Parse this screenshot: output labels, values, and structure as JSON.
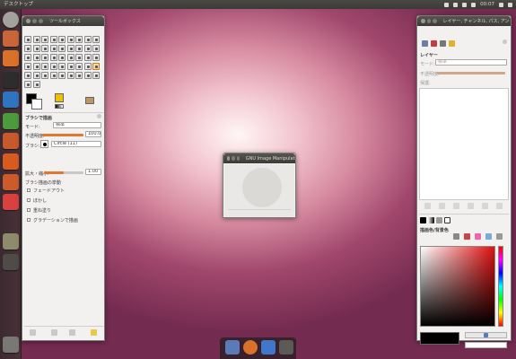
{
  "topbar": {
    "title": "デスクトップ",
    "time": "00:07"
  },
  "launcher": {
    "items": [
      {
        "name": "dash-home-icon",
        "color": "#a3a29d"
      },
      {
        "name": "files-icon",
        "color": "#c8653a"
      },
      {
        "name": "firefox-icon",
        "color": "#d9712a"
      },
      {
        "name": "terminal-icon",
        "color": "#2d2d2d"
      },
      {
        "name": "writer-icon",
        "color": "#2f74c0"
      },
      {
        "name": "calc-icon",
        "color": "#4b9a3b"
      },
      {
        "name": "impress-icon",
        "color": "#c75a2c"
      },
      {
        "name": "software-center-icon",
        "color": "#d85a1f"
      },
      {
        "name": "ubuntu-one-icon",
        "color": "#cc5a2a"
      },
      {
        "name": "settings-icon",
        "color": "#d94040"
      },
      {
        "name": "gimp-icon",
        "color": "#8e8a6c"
      },
      {
        "name": "workspace-switcher-icon",
        "color": "#4f4c48"
      },
      {
        "name": "trash-icon",
        "color": "#7a7875"
      }
    ]
  },
  "toolbox": {
    "title": "ツールボックス",
    "options_title": "ブラシで描画",
    "mode_label": "モード:",
    "mode_value": "標準",
    "opacity_label": "不透明度:",
    "opacity_value": "100.0",
    "opacity_level": 1.0,
    "brush_label": "ブラシ:",
    "brush_value": "Circle (11)",
    "size_label": "拡大・縮小:",
    "size_value": "1.00",
    "size_level": 0.5,
    "dynamics_label": "ブラシ描画の挙動",
    "options": [
      "フェードアウト",
      "ぼかし",
      "重ね塗り",
      "グラデーションで描画"
    ]
  },
  "gimp_main": {
    "title": "GNU Image Manipulation Program"
  },
  "layers": {
    "title": "レイヤー, チャンネル, パス, アンドゥ",
    "tab_label": "レイヤー",
    "mode_label": "モード:",
    "mode_value": "標準",
    "opacity_label": "不透明度:",
    "lock_label": "保護:"
  },
  "colors": {
    "title": "描画色/背景色",
    "fg": "#000000",
    "bg": "#ffffff",
    "hue_color": "#e01010"
  },
  "dock": {
    "items": [
      "file-manager-icon",
      "firefox-icon",
      "thunderbird-icon",
      "gimp-icon"
    ]
  }
}
